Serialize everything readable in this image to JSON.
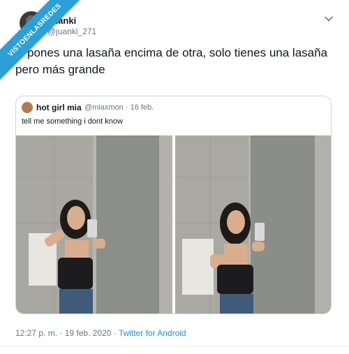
{
  "watermark": {
    "text": "VISTOENLASREDES"
  },
  "tweet": {
    "author_name": "Juanki",
    "author_handle": "@juanki_271",
    "text": "si pones una lasaña encima de otra, solo tienes una lasaña pero más grande",
    "timestamp": "12:27 p. m. · 19 feb. 2020",
    "source_separator": " · ",
    "source": "Twitter for Android",
    "menu_icon": "chevron-down-icon"
  },
  "quoted": {
    "author_name": "hot girl mia",
    "author_handle": "@miaxmon",
    "date": "· 16 feb.",
    "text": "tell me something i dont know",
    "media_count": 2
  },
  "colors": {
    "ribbon": "#2a9fd8",
    "link": "#1b95e0",
    "text": "#14171a",
    "muted": "#657786",
    "border": "#ccd6dd"
  }
}
